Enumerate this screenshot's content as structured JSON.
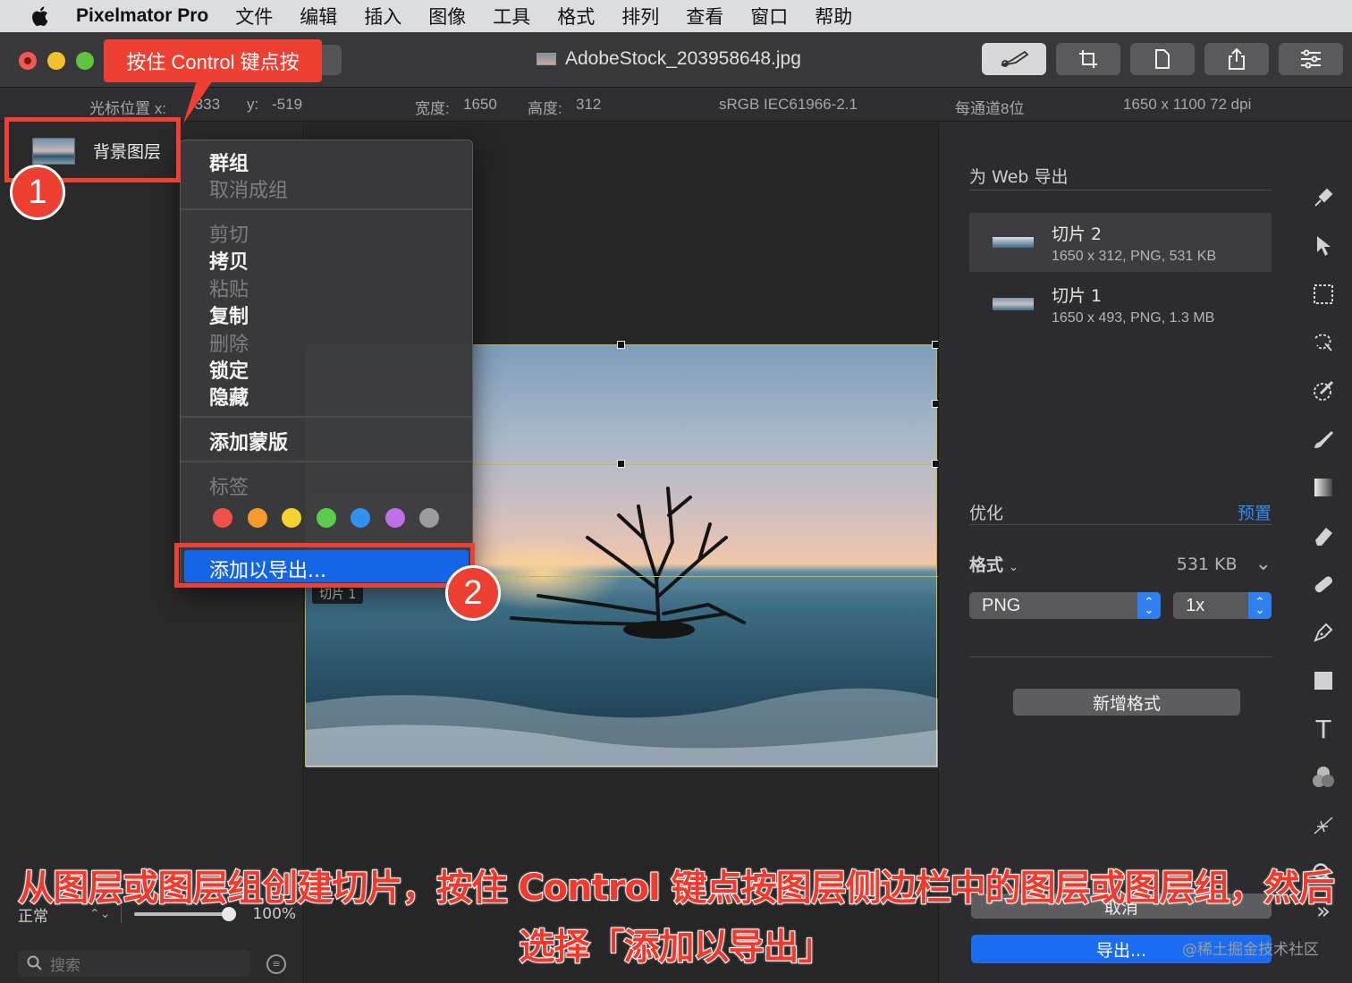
{
  "menubar": {
    "app_name": "Pixelmator Pro",
    "items": [
      "文件",
      "编辑",
      "插入",
      "图像",
      "工具",
      "格式",
      "排列",
      "查看",
      "窗口",
      "帮助"
    ]
  },
  "window": {
    "title": "AdobeStock_203958648.jpg"
  },
  "infobar": {
    "cursor_x_label": "光标位置 x:",
    "cursor_x": "-333",
    "cursor_y_label": "y:",
    "cursor_y": "-519",
    "width_label": "宽度:",
    "width": "1650",
    "height_label": "高度:",
    "height": "312",
    "color_profile": "sRGB IEC61966-2.1",
    "bit_depth": "每通道8位",
    "dimensions": "1650 x 1100 72 dpi"
  },
  "layers": {
    "items": [
      {
        "name": "背景图层"
      }
    ],
    "blend_mode": "正常",
    "opacity": "100%",
    "opacity_fraction": 1.0,
    "search_placeholder": "搜索"
  },
  "canvas": {
    "slice_label": "切片 1"
  },
  "context_menu": {
    "group": "群组",
    "ungroup": "取消成组",
    "cut": "剪切",
    "copy": "拷贝",
    "paste": "粘贴",
    "duplicate": "复制",
    "delete": "删除",
    "lock": "锁定",
    "hide": "隐藏",
    "add_mask": "添加蒙版",
    "tags": "标签",
    "tag_colors": [
      "#f0524a",
      "#f49a2c",
      "#f6d231",
      "#5ccb4c",
      "#2f92ef",
      "#c06fe9",
      "#9b9b9d"
    ],
    "add_to_export": "添加以导出..."
  },
  "export_panel": {
    "title": "为 Web 导出",
    "slices": [
      {
        "name": "切片 2",
        "meta": "1650 x 312, PNG, 531 KB"
      },
      {
        "name": "切片 1",
        "meta": "1650 x 493, PNG, 1.3 MB"
      }
    ],
    "optimize_label": "优化",
    "preset_label": "预置",
    "format_label": "格式",
    "format_size": "531 KB",
    "format_value": "PNG",
    "scale_value": "1x",
    "add_format": "新增格式",
    "cancel": "取消",
    "export": "导出..."
  },
  "tools": [
    "style-tool-icon",
    "arrange-tool-icon",
    "selection-tool-icon",
    "smart-selection-icon",
    "color-picker-icon",
    "paint-brush-icon",
    "gradient-icon",
    "eraser-icon",
    "repair-icon",
    "pen-tool-icon",
    "shape-tool-icon",
    "type-tool-icon",
    "effects-icon",
    "distort-icon",
    "zoom-tool-icon",
    "more-tools-icon"
  ],
  "tool_glyphs": {
    "type": "T",
    "more": "»"
  },
  "annotations": {
    "callout": "按住 Control 键点按",
    "badge1": "1",
    "badge2": "2",
    "caption_line1": "从图层或图层组创建切片，按住 Control 键点按图层侧边栏中的图层或图层组，然后",
    "caption_line2": "选择「添加以导出」",
    "watermark": "@稀土掘金技术社区"
  }
}
